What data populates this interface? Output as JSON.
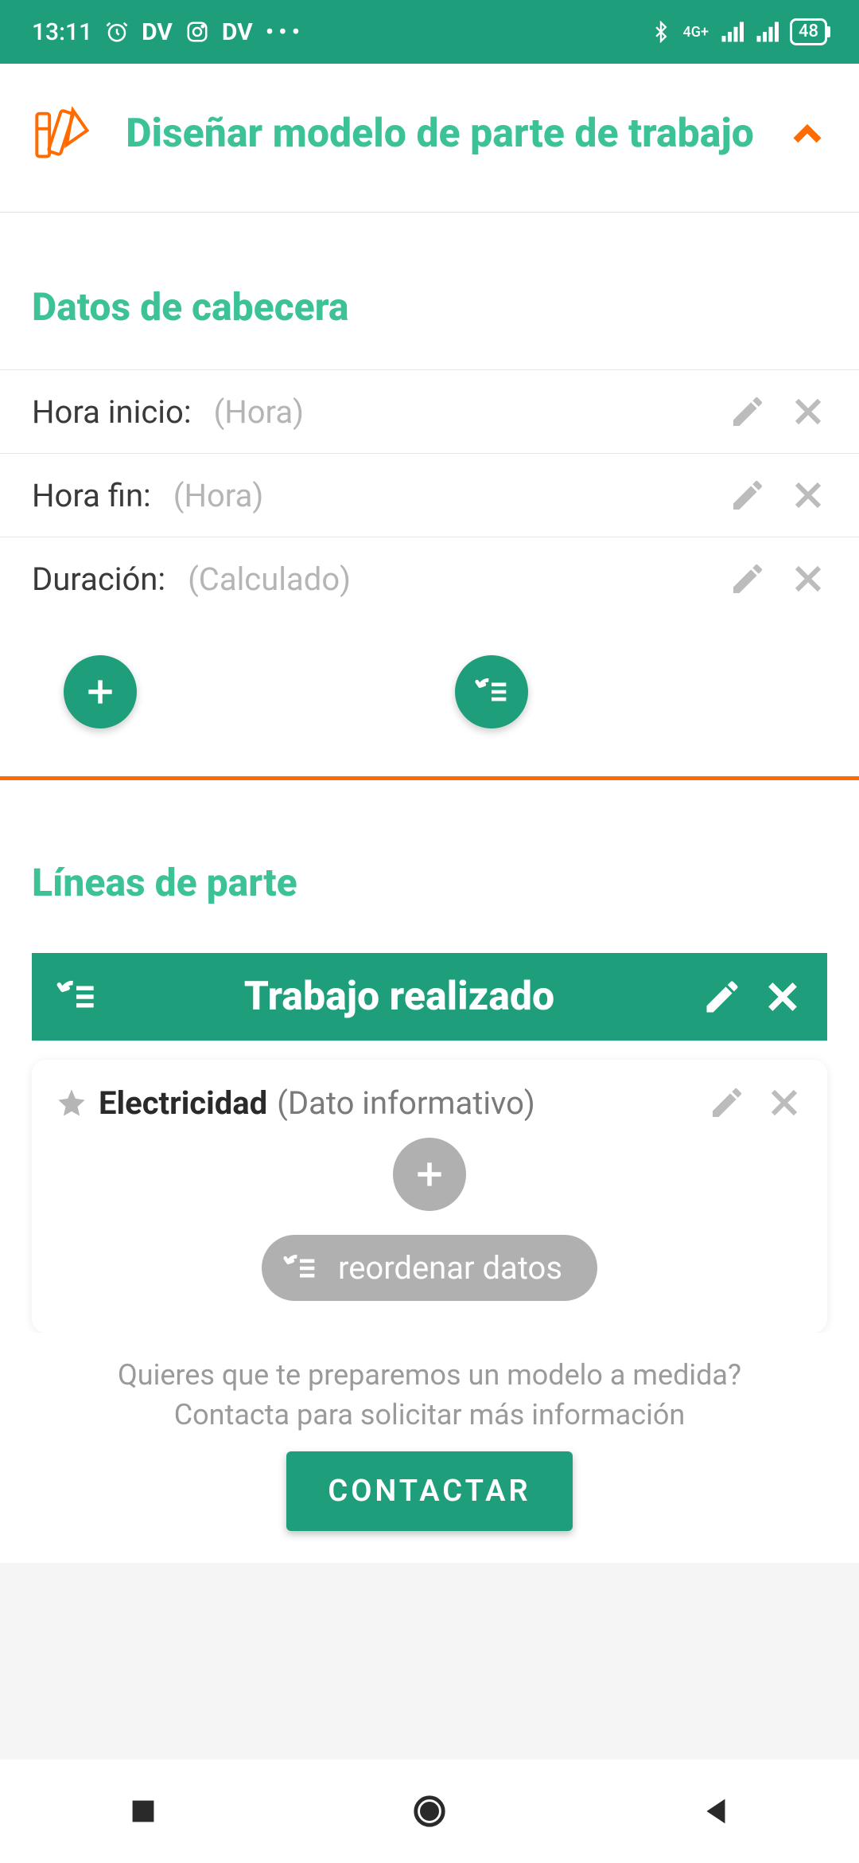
{
  "status": {
    "time": "13:11",
    "badges": [
      "DV",
      "DV"
    ],
    "network": "4G+",
    "battery": "48"
  },
  "header": {
    "title": "Diseñar modelo de parte de trabajo"
  },
  "section_header": {
    "title": "Datos de cabecera",
    "rows": [
      {
        "label": "Hora inicio:",
        "hint": "(Hora)"
      },
      {
        "label": "Hora fin:",
        "hint": "(Hora)"
      },
      {
        "label": "Duración:",
        "hint": "(Calculado)"
      }
    ]
  },
  "lines": {
    "title": "Líneas de parte",
    "group_title": "Trabajo realizado",
    "item": {
      "title": "Electricidad",
      "subtitle": "(Dato informativo)"
    },
    "reorder_label": "reordenar datos"
  },
  "footer": {
    "line1": "Quieres que te preparemos un modelo a medida?",
    "line2": "Contacta para solicitar más información",
    "button": "CONTACTAR"
  }
}
